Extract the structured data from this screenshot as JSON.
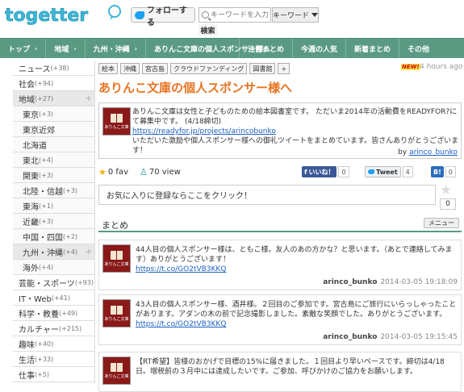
{
  "header": {
    "logo_text": "togetter",
    "follow_label": "フォローする",
    "search_placeholder": "キーワードを入力",
    "search_type": "キーワード",
    "search_button": "検索"
  },
  "nav": {
    "breadcrumb": [
      "トップ",
      "地域",
      "九州・沖縄",
      "ありんこ文庫の個人スポンサー様へ"
    ],
    "right": [
      "注目まとめ",
      "今週の人気",
      "新着まとめ",
      "その他"
    ]
  },
  "sidebar": {
    "items": [
      {
        "label": "ニュース",
        "count": "(+38)",
        "sub": false,
        "active": false,
        "plus": false
      },
      {
        "label": "社会",
        "count": "(+94)",
        "sub": false,
        "active": false,
        "plus": false
      },
      {
        "label": "地域",
        "count": "(+27)",
        "sub": false,
        "active": true,
        "plus": true
      },
      {
        "label": "東京",
        "count": "(+3)",
        "sub": true,
        "active": false,
        "plus": false
      },
      {
        "label": "東京近郊",
        "count": "",
        "sub": true,
        "active": false,
        "plus": false
      },
      {
        "label": "北海道",
        "count": "",
        "sub": true,
        "active": false,
        "plus": false
      },
      {
        "label": "東北",
        "count": "(+4)",
        "sub": true,
        "active": false,
        "plus": false
      },
      {
        "label": "関東",
        "count": "(+3)",
        "sub": true,
        "active": false,
        "plus": false
      },
      {
        "label": "北陸・信越",
        "count": "(+3)",
        "sub": true,
        "active": false,
        "plus": false
      },
      {
        "label": "東海",
        "count": "(+1)",
        "sub": true,
        "active": false,
        "plus": false
      },
      {
        "label": "近畿",
        "count": "(+3)",
        "sub": true,
        "active": false,
        "plus": false
      },
      {
        "label": "中国・四国",
        "count": "(+2)",
        "sub": true,
        "active": false,
        "plus": false
      },
      {
        "label": "九州・沖縄",
        "count": "(+4)",
        "sub": true,
        "active": true,
        "plus": true
      },
      {
        "label": "海外",
        "count": "(+4)",
        "sub": true,
        "active": false,
        "plus": false
      },
      {
        "label": "芸能・スポーツ",
        "count": "(+93)",
        "sub": false,
        "active": false,
        "plus": false
      },
      {
        "label": "IT・Web",
        "count": "(+41)",
        "sub": false,
        "active": false,
        "plus": false
      },
      {
        "label": "科学・教養",
        "count": "(+49)",
        "sub": false,
        "active": false,
        "plus": false
      },
      {
        "label": "カルチャー",
        "count": "(+215)",
        "sub": false,
        "active": false,
        "plus": false
      },
      {
        "label": "趣味",
        "count": "(+40)",
        "sub": false,
        "active": false,
        "plus": false
      },
      {
        "label": "生活",
        "count": "(+33)",
        "sub": false,
        "active": false,
        "plus": false
      },
      {
        "label": "仕事",
        "count": "(+5)",
        "sub": false,
        "active": false,
        "plus": false
      }
    ]
  },
  "article": {
    "tags": [
      "絵本",
      "沖縄",
      "宮古島",
      "クラウドファンディング",
      "図書館",
      "+"
    ],
    "new_badge": "NEW!",
    "time_ago": "4 hours ago",
    "title": "ありんこ文庫の個人スポンサー様へ",
    "description_line1": "ありんこ文庫は女性と子どものための絵本図書室です。 ただいま2014年の活動費をREADYFOR?にて募集中です。 (4/18締切)",
    "description_link": "https://readyfor.jp/projects/arincobunko",
    "description_line2": "いただいた激励や個人スポンサー様への御礼ツイートをまとめています。皆さんありがとうございます！",
    "by_label": "by",
    "author": "arinco_bunko",
    "avatar_text": "ありんこ文庫",
    "fav_count": "0 fav",
    "view_count": "70 view",
    "fb_label": "いいね！",
    "fb_count": "0",
    "tw_label": "Tweet",
    "tw_count": "4",
    "hb_label": "B!",
    "hb_count": "0",
    "fav_prompt": "お気に入りに登録ならここをクリック！",
    "fav_star_count": "0"
  },
  "summary": {
    "title": "まとめ",
    "menu": "メニュー"
  },
  "tweets": [
    {
      "text": "44人目の個人スポンサー様は、ともこ様。友人のあの方かな？と思います。（あとで連絡してみます）ありがとうございます！",
      "link": "https://t.co/GO2tVB3KKQ",
      "author": "arinco_bunko",
      "time": "2014-03-05 19:18:09"
    },
    {
      "text": "43人目の個人スポンサー様、酒井様。２回目のご参加です。宮古島にご旅行にいらっしゃったことがあります。アダンの木の前で記念撮影しました。素敵な笑顔でした。ありがとうございます。",
      "link": "https://t.co/GO2tVB3KKQ",
      "author": "arinco_bunko",
      "time": "2014-03-05 19:15:45"
    },
    {
      "text": "【RT希望】皆様のおかげで目標の15%に届きました。１回目より早いペースです。締切は4/18日。増税前の３月中には達成したいです。ご参加、呼びかけのご協力をお願いします。",
      "link": "",
      "author": "",
      "time": ""
    }
  ],
  "colors": {
    "accent": "#e87422",
    "nav": "#5a9a83",
    "link": "#1a5fc0",
    "logo": "#3cb8d8"
  }
}
